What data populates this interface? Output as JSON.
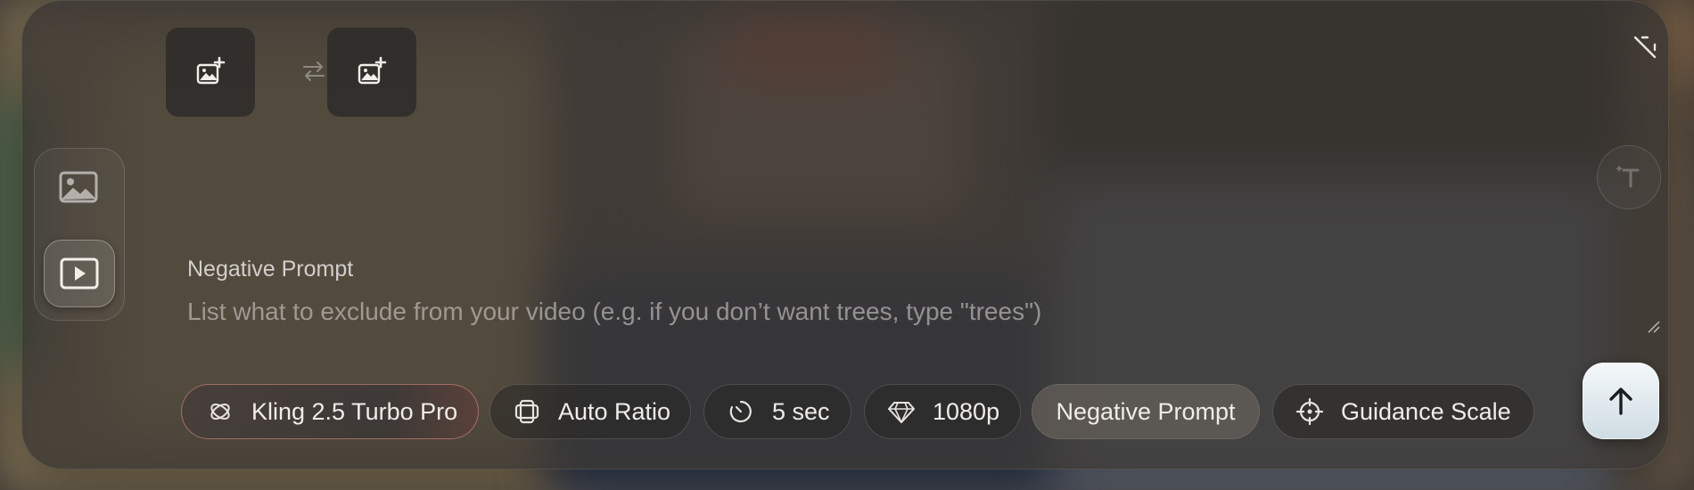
{
  "references": {
    "start_frame_tooltip": "",
    "end_frame_tooltip": ""
  },
  "mode_toggle": {
    "image_icon": "image-icon",
    "video_icon": "video-icon",
    "active": "video"
  },
  "negative_prompt": {
    "label": "Negative Prompt",
    "placeholder": "List what to exclude from your video (e.g. if you don’t want trees, type \"trees\")",
    "value": ""
  },
  "toolbar": {
    "model_label": "Kling 2.5 Turbo Pro",
    "ratio_label": "Auto Ratio",
    "duration_label": "5 sec",
    "resolution_label": "1080p",
    "negative_prompt_label": "Negative Prompt",
    "guidance_label": "Guidance Scale"
  },
  "colors": {
    "panel": "#3a3632",
    "model_accent": "#f0968c",
    "submit": "#dfe9ee"
  }
}
